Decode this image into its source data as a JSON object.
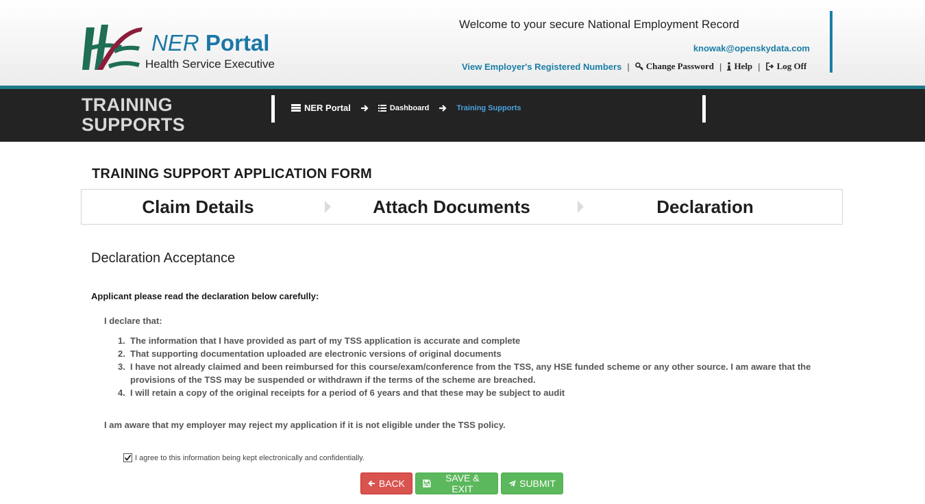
{
  "header": {
    "portal_title_ner": "NER",
    "portal_title_portal": "Portal",
    "org_name": "Health Service Executive",
    "welcome": "Welcome to your secure National Employment Record",
    "user_email": "knowak@openskydata.com",
    "links": {
      "employer_numbers": "View Employer's Registered Numbers",
      "change_password": "Change Password",
      "help": "Help",
      "log_off": "Log Off",
      "separator": "|"
    }
  },
  "section": {
    "title_line1": "TRAINING",
    "title_line2": "SUPPORTS"
  },
  "breadcrumb": {
    "items": [
      "NER Portal",
      "Dashboard",
      "Training Supports"
    ]
  },
  "form": {
    "title": "TRAINING SUPPORT APPLICATION FORM",
    "steps": [
      "Claim Details",
      "Attach Documents",
      "Declaration"
    ],
    "declaration_heading": "Declaration Acceptance",
    "instruction": "Applicant please read the declaration below carefully:",
    "declare_intro": "I declare that:",
    "declarations": [
      {
        "num": "1.",
        "text": "The information that I have provided as part of my TSS application is accurate and complete"
      },
      {
        "num": "2.",
        "text": "That supporting documentation uploaded are electronic versions of original documents"
      },
      {
        "num": "3.",
        "text": "I have not already claimed and been reimbursed for this course/exam/conference from the TSS, any HSE funded scheme or any other source. I am aware that the provisions of the TSS may be suspended or withdrawn if the terms of the scheme are breached."
      },
      {
        "num": "4.",
        "text": "I will retain a copy of the original receipts for a period of 6 years and that these may be subject to audit"
      }
    ],
    "aware": "I am aware that my employer may reject my application if it is not eligible under the TSS policy.",
    "agree_label": "I agree to this information being kept electronically and confidentially.",
    "agree_checked": true
  },
  "buttons": {
    "back": "BACK",
    "save_exit": "SAVE & EXIT",
    "submit": "SUBMIT"
  },
  "colors": {
    "brand_blue": "#1a7ea6",
    "teal_strip": "#1c7a8a",
    "dark_bar": "#232323",
    "danger": "#d9534f",
    "success": "#5cb85c"
  }
}
